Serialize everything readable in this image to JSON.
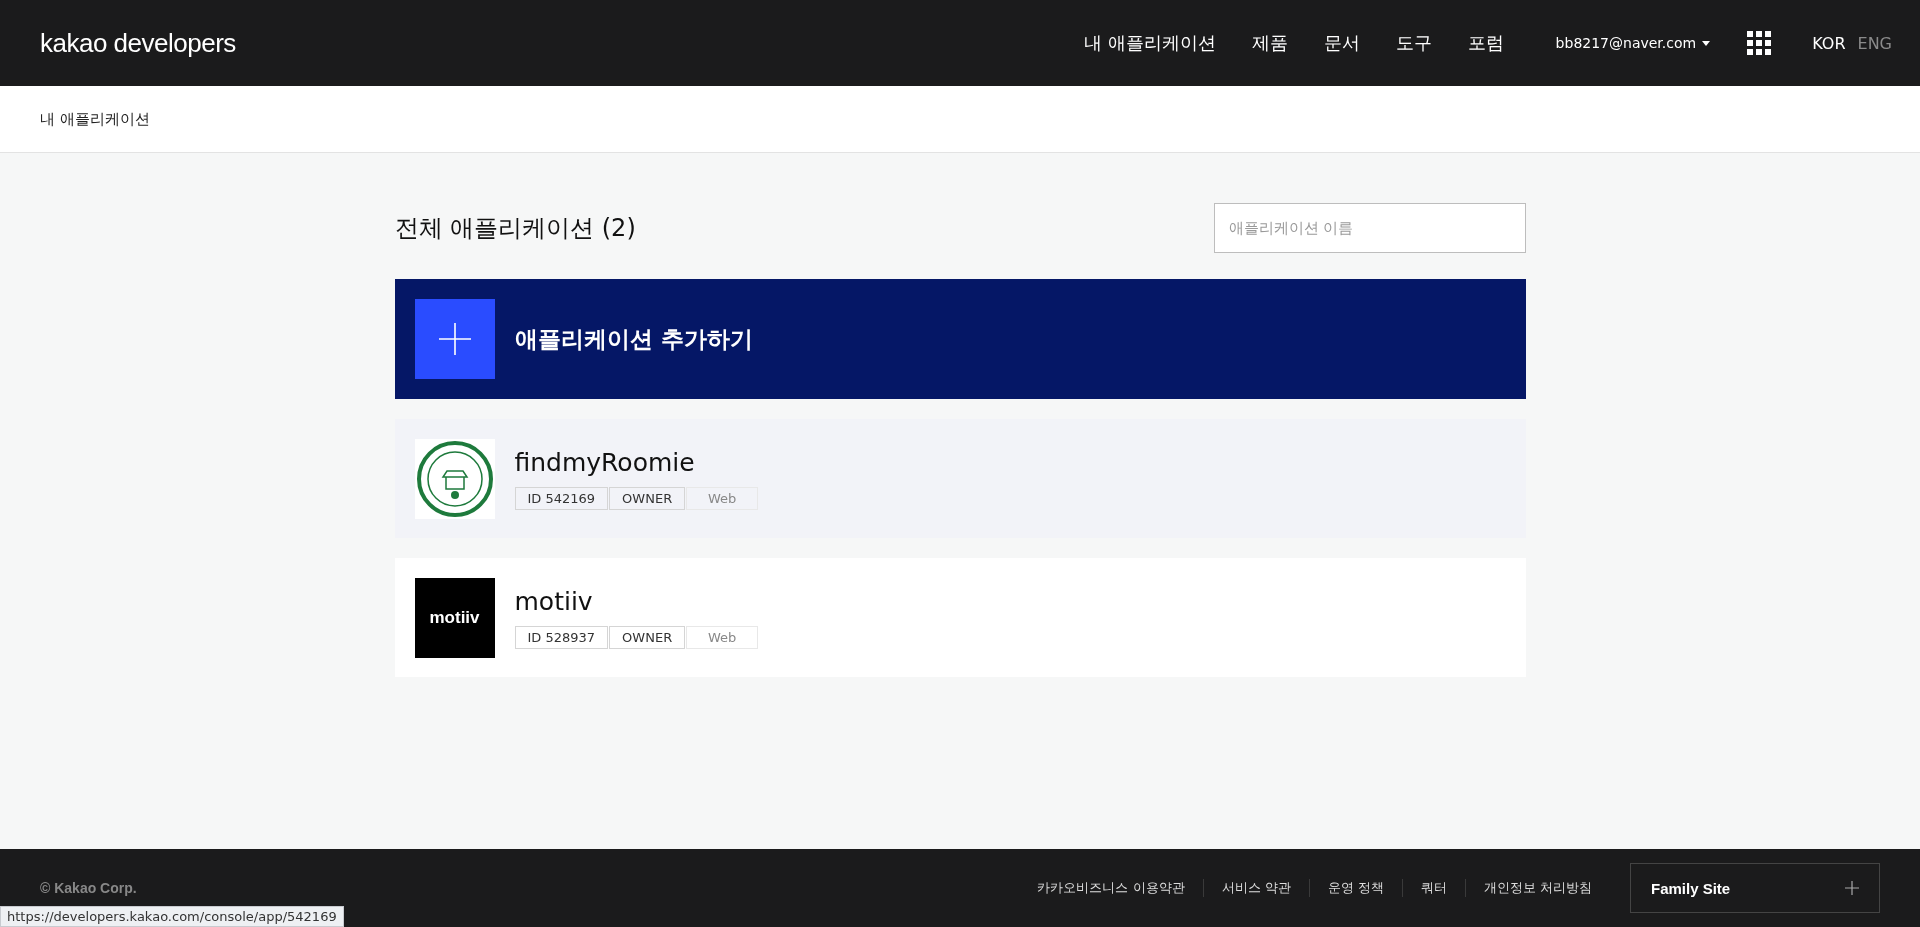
{
  "header": {
    "logo": "kakao developers",
    "nav": [
      {
        "label": "내 애플리케이션"
      },
      {
        "label": "제품"
      },
      {
        "label": "문서"
      },
      {
        "label": "도구"
      },
      {
        "label": "포럼"
      }
    ],
    "account": "bb8217@naver.com",
    "languages": [
      {
        "label": "KOR",
        "selected": true
      },
      {
        "label": "ENG",
        "selected": false
      }
    ]
  },
  "breadcrumb": "내 애플리케이션",
  "title": "전체 애플리케이션 (2)",
  "search": {
    "placeholder": "애플리케이션 이름"
  },
  "add_button": "애플리케이션 추가하기",
  "apps": [
    {
      "name": "findmyRoomie",
      "kind": "emblem",
      "hovered": true,
      "tags": [
        {
          "label": "ID 542169",
          "kind": "strong"
        },
        {
          "label": "OWNER",
          "kind": "strong"
        },
        {
          "label": "Web",
          "kind": "muted"
        }
      ]
    },
    {
      "name": "motiiv",
      "kind": "wordmark",
      "logo_text": "motiiv",
      "hovered": false,
      "tags": [
        {
          "label": "ID 528937",
          "kind": "strong"
        },
        {
          "label": "OWNER",
          "kind": "strong"
        },
        {
          "label": "Web",
          "kind": "muted"
        }
      ]
    }
  ],
  "footer": {
    "copyright": "© Kakao Corp.",
    "links": [
      "카카오비즈니스 이용약관",
      "서비스 약관",
      "운영 정책",
      "쿼터",
      "개인정보 처리방침"
    ],
    "family_site": "Family Site"
  },
  "status_url": "https://developers.kakao.com/console/app/542169"
}
